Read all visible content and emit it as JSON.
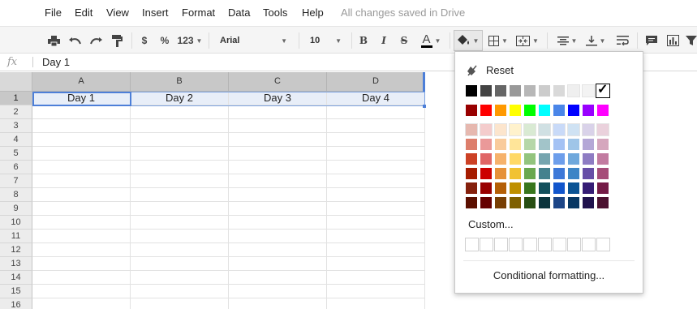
{
  "menu": {
    "items": [
      "File",
      "Edit",
      "View",
      "Insert",
      "Format",
      "Data",
      "Tools",
      "Help"
    ],
    "saved_status": "All changes saved in Drive"
  },
  "toolbar": {
    "currency": "$",
    "percent": "%",
    "number_format": "123",
    "font": "Arial",
    "font_size": "10",
    "bold": "B",
    "italic": "I",
    "strike": "S",
    "text_color": "A"
  },
  "formula_bar": {
    "fx_label": "fx",
    "value": "Day 1"
  },
  "sheet": {
    "columns": [
      "A",
      "B",
      "C",
      "D"
    ],
    "rows": [
      "1",
      "2",
      "3",
      "4",
      "5",
      "6",
      "7",
      "8",
      "9",
      "10",
      "11",
      "12",
      "13",
      "14",
      "15",
      "16"
    ],
    "row1": [
      "Day 1",
      "Day 2",
      "Day 3",
      "Day 4"
    ]
  },
  "fill_popup": {
    "reset_label": "Reset",
    "custom_label": "Custom...",
    "conditional_label": "Conditional formatting...",
    "grays": [
      "#000000",
      "#434343",
      "#666666",
      "#999999",
      "#b7b7b7",
      "#cccccc",
      "#d9d9d9",
      "#efefef",
      "#f3f3f3",
      "#ffffff"
    ],
    "selected_index": 9,
    "brights": [
      "#980000",
      "#ff0000",
      "#ff9900",
      "#ffff00",
      "#00ff00",
      "#00ffff",
      "#4a86e8",
      "#0000ff",
      "#9900ff",
      "#ff00ff"
    ],
    "tints": [
      [
        "#e6b8af",
        "#f4cccc",
        "#fce5cd",
        "#fff2cc",
        "#d9ead3",
        "#d0e0e3",
        "#c9daf8",
        "#cfe2f3",
        "#d9d2e9",
        "#ead1dc"
      ],
      [
        "#dd7e6b",
        "#ea9999",
        "#f9cb9c",
        "#ffe599",
        "#b6d7a8",
        "#a2c4c9",
        "#a4c2f4",
        "#9fc5e8",
        "#b4a7d6",
        "#d5a6bd"
      ],
      [
        "#cc4125",
        "#e06666",
        "#f6b26b",
        "#ffd966",
        "#93c47d",
        "#76a5af",
        "#6d9eeb",
        "#6fa8dc",
        "#8e7cc3",
        "#c27ba0"
      ],
      [
        "#a61c00",
        "#cc0000",
        "#e69138",
        "#f1c232",
        "#6aa84f",
        "#45818e",
        "#3c78d8",
        "#3d85c6",
        "#674ea7",
        "#a64d79"
      ],
      [
        "#85200c",
        "#990000",
        "#b45f06",
        "#bf9000",
        "#38761d",
        "#134f5c",
        "#1155cc",
        "#0b5394",
        "#351c75",
        "#741b47"
      ],
      [
        "#5b0f00",
        "#660000",
        "#783f04",
        "#7f6000",
        "#274e13",
        "#0c343d",
        "#1c4587",
        "#073763",
        "#20124d",
        "#4c1130"
      ]
    ]
  }
}
